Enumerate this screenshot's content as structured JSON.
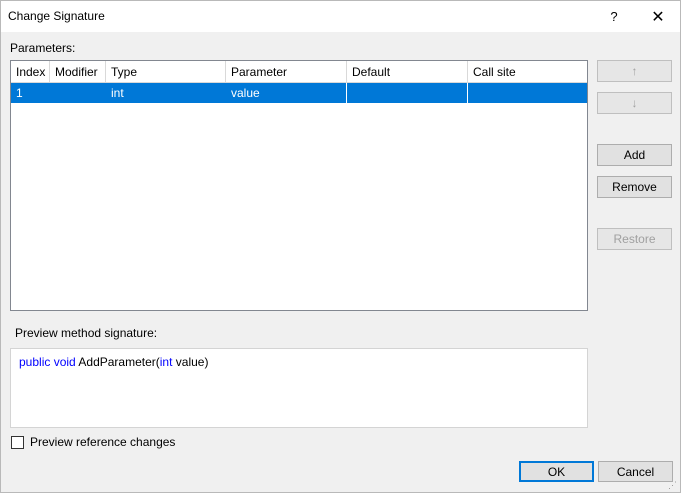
{
  "window": {
    "title": "Change Signature",
    "help_label": "?",
    "close_label": "✕"
  },
  "parameters": {
    "label": "Parameters:",
    "columns": [
      "Index",
      "Modifier",
      "Type",
      "Parameter",
      "Default",
      "Call site"
    ],
    "rows": [
      {
        "index": "1",
        "modifier": "",
        "type": "int",
        "parameter": "value",
        "default": "",
        "call_site": ""
      }
    ]
  },
  "side_buttons": {
    "up_label": "↑",
    "down_label": "↓",
    "add_label": "Add",
    "remove_label": "Remove",
    "restore_label": "Restore"
  },
  "preview": {
    "label": "Preview method signature:",
    "tokens": [
      {
        "text": "public",
        "kind": "keyword"
      },
      {
        "text": " ",
        "kind": "plain"
      },
      {
        "text": "void",
        "kind": "keyword"
      },
      {
        "text": " AddParameter(",
        "kind": "plain"
      },
      {
        "text": "int",
        "kind": "keyword"
      },
      {
        "text": " value)",
        "kind": "plain"
      }
    ]
  },
  "options": {
    "preview_reference_changes_label": "Preview reference changes",
    "preview_reference_changes_checked": false
  },
  "footer": {
    "ok_label": "OK",
    "cancel_label": "Cancel"
  },
  "colors": {
    "selection": "#0078d7",
    "keyword": "#0000ff"
  }
}
